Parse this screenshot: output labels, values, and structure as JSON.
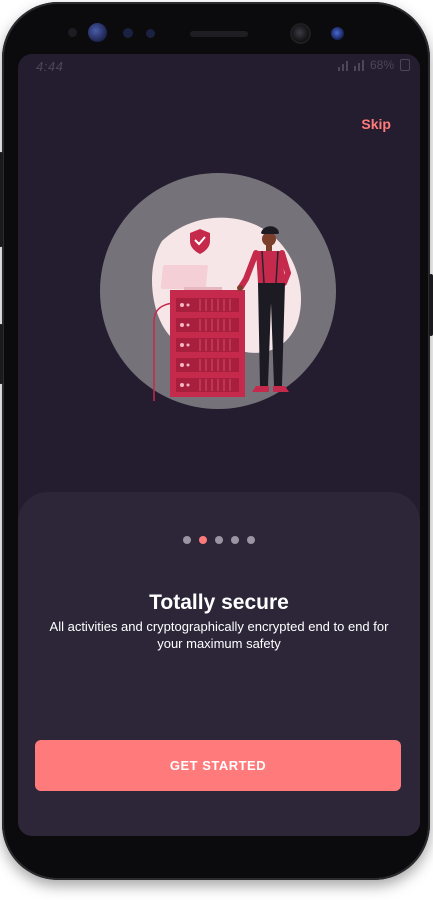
{
  "status_bar": {
    "time": "4:44",
    "battery": "68%"
  },
  "header": {
    "skip_label": "Skip"
  },
  "onboarding": {
    "illustration_icon": "secure-server-person",
    "page_count": 5,
    "active_page": 2,
    "title": "Totally secure",
    "subtitle": "All activities and cryptographically encrypted end to end for your maximum safety",
    "cta_label": "GET STARTED"
  },
  "colors": {
    "background": "#241d2f",
    "sheet": "#2d2639",
    "accent": "#ff7b7b",
    "dot_inactive": "#9b95a3",
    "text": "#ffffff"
  }
}
